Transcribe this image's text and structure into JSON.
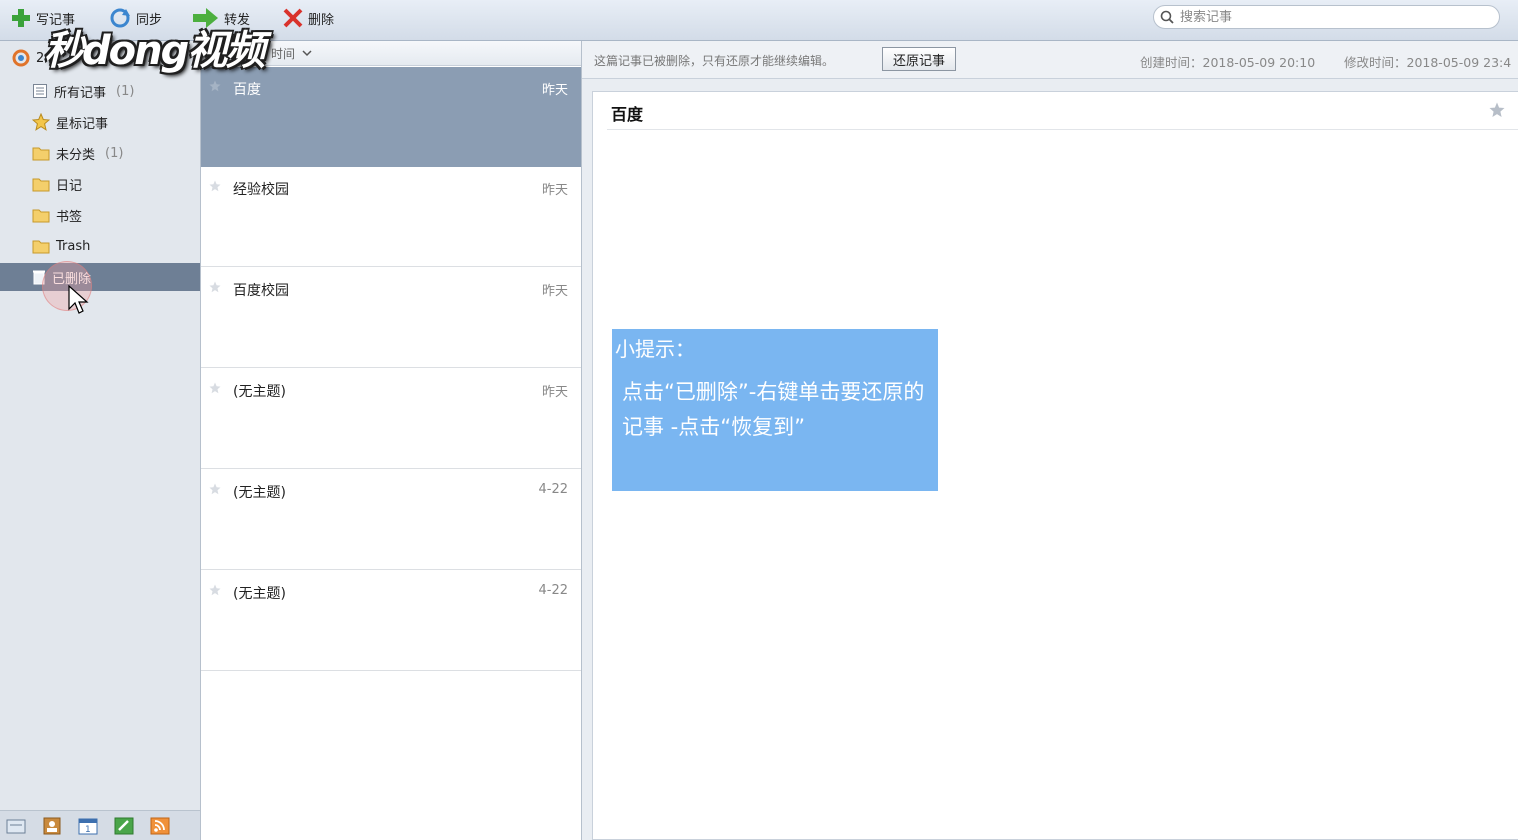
{
  "toolbar": {
    "new_note": "写记事",
    "sync": "同步",
    "forward": "转发",
    "delete": "删除",
    "search_placeholder": "搜索记事"
  },
  "sidebar": {
    "account_label": "2",
    "items": [
      {
        "label": "所有记事",
        "count": "(1)",
        "icon": "notes-icon"
      },
      {
        "label": "星标记事",
        "count": "",
        "icon": "star-icon"
      },
      {
        "label": "未分类",
        "count": "(1)",
        "icon": "folder-icon"
      },
      {
        "label": "日记",
        "count": "",
        "icon": "folder-icon"
      },
      {
        "label": "书签",
        "count": "",
        "icon": "folder-icon"
      },
      {
        "label": "Trash",
        "count": "",
        "icon": "folder-icon"
      },
      {
        "label": "已删除",
        "count": "",
        "icon": "trash-icon",
        "selected": true
      }
    ]
  },
  "list": {
    "sort_label": "时间",
    "notes": [
      {
        "title": "百度",
        "date": "昨天",
        "selected": true
      },
      {
        "title": "经验校园",
        "date": "昨天"
      },
      {
        "title": "百度校园",
        "date": "昨天"
      },
      {
        "title": "(无主题)",
        "date": "昨天"
      },
      {
        "title": "(无主题)",
        "date": "4-22"
      },
      {
        "title": "(无主题)",
        "date": "4-22"
      }
    ]
  },
  "content": {
    "deleted_message": "这篇记事已被删除，只有还原才能继续编辑。",
    "restore_button": "还原记事",
    "created": "创建时间：2018-05-09 20:10",
    "modified": "修改时间：2018-05-09 23:4",
    "note_title": "百度"
  },
  "overlay": {
    "logo": "秒dong视频",
    "tip_title": "小提示：",
    "tip_body": "点击“已删除”-右键单击要还原的记事 -点击“恢复到”"
  },
  "colors": {
    "selection": "#6e7f95",
    "note_selected": "#8b9db3",
    "tip_background": "#7ab6f1"
  }
}
